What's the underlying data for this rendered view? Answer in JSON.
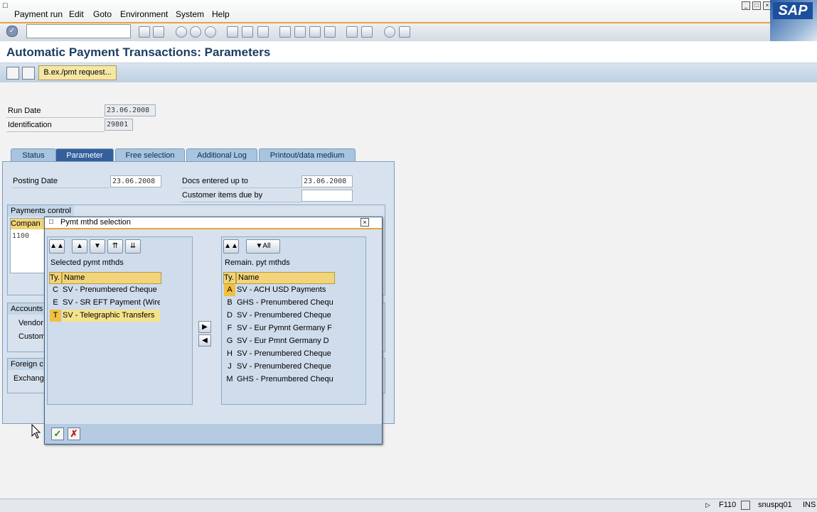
{
  "menu": {
    "items": [
      "Payment run",
      "Edit",
      "Goto",
      "Environment",
      "System",
      "Help"
    ]
  },
  "brand": {
    "logo_text": "SAP"
  },
  "page": {
    "title": "Automatic Payment Transactions: Parameters",
    "bex_button": "B.ex./pmt request..."
  },
  "header_fields": {
    "run_date_label": "Run Date",
    "run_date_value": "23.06.2008",
    "identification_label": "Identification",
    "identification_value": "29801"
  },
  "tabs": [
    "Status",
    "Parameter",
    "Free selection",
    "Additional Log",
    "Printout/data medium"
  ],
  "parameter_tab": {
    "posting_date_label": "Posting Date",
    "posting_date_value": "23.06.2008",
    "docs_entered_label": "Docs entered up to",
    "docs_entered_value": "23.06.2008",
    "customer_items_label": "Customer items due by",
    "payments_control_title": "Payments control",
    "company_code_header": "Compan",
    "company_code_value": "1100",
    "accounts_title": "Accounts",
    "vendor_label": "Vendor",
    "customer_label": "Custom",
    "foreign_title": "Foreign c",
    "exchange_label": "Exchang"
  },
  "dialog": {
    "title": "Pymt mthd selection",
    "left_panel": {
      "label": "Selected pymt mthds",
      "col_ty": "Ty.",
      "col_name": "Name",
      "rows": [
        {
          "ty": "C",
          "name": "SV - Prenumbered Cheque"
        },
        {
          "ty": "E",
          "name": "SV - SR EFT Payment (Wire"
        },
        {
          "ty": "T",
          "name": "SV - Telegraphic Transfers"
        }
      ]
    },
    "right_panel": {
      "label": "Remain. pyt mthds",
      "filter_all": "All",
      "col_ty": "Ty.",
      "col_name": "Name",
      "rows": [
        {
          "ty": "A",
          "name": "SV - ACH USD Payments"
        },
        {
          "ty": "B",
          "name": "GHS - Prenumbered Cheque"
        },
        {
          "ty": "D",
          "name": "SV - Prenumbered Cheque"
        },
        {
          "ty": "F",
          "name": "SV - Eur Pymnt Germany F"
        },
        {
          "ty": "G",
          "name": "SV - Eur Pmnt Germany D"
        },
        {
          "ty": "H",
          "name": "SV - Prenumbered Cheque"
        },
        {
          "ty": "J",
          "name": "SV - Prenumbered Cheque"
        },
        {
          "ty": "M",
          "name": "GHS - Prenumbered Cheque"
        }
      ]
    }
  },
  "statusbar": {
    "transaction": "F110",
    "server": "snuspq01",
    "mode": "INS"
  },
  "colors": {
    "accent": "#e8a43c",
    "title_blue": "#1d3d63",
    "active_tab": "#33609a",
    "selection_yellow": "#f5e38b"
  }
}
